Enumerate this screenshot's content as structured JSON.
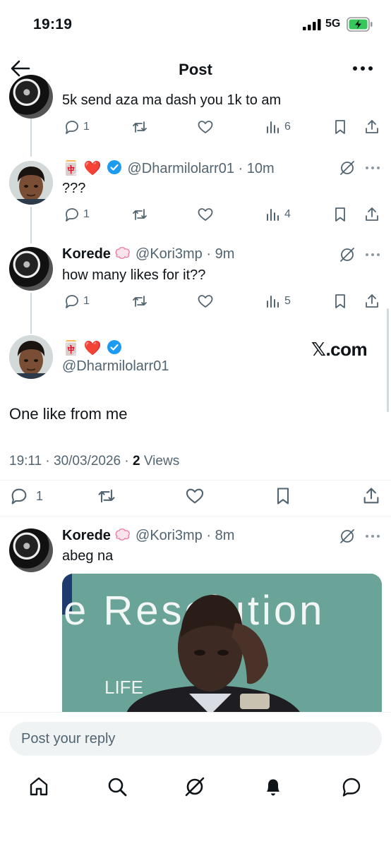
{
  "status_bar": {
    "time": "19:19",
    "network": "5G"
  },
  "header": {
    "title": "Post"
  },
  "replies_above": [
    {
      "text": "5k send aza ma dash you 1k to am",
      "stats": {
        "replies": "1",
        "views": "6"
      }
    },
    {
      "emoji": "🀄 ❤️",
      "handle": "@Dharmilolarr01",
      "time": "· 10m",
      "text": "???",
      "stats": {
        "replies": "1",
        "views": "4"
      }
    },
    {
      "name": "Korede",
      "handle": "@Kori3mp",
      "time": "· 9m",
      "text": "how many likes for it??",
      "stats": {
        "replies": "1",
        "views": "5"
      }
    }
  ],
  "main_post": {
    "emoji": "🀄 ❤️",
    "handle": "@Dharmilolarr01",
    "watermark": "𝕏.com",
    "text": "One like from me",
    "timestamp": "19:11 · 30/03/2026 · ",
    "views_count": "2",
    "views_label": " Views",
    "stats": {
      "replies": "1"
    }
  },
  "reply_below": {
    "name": "Korede",
    "handle": "@Kori3mp",
    "time": "· 8m",
    "text": "abeg na",
    "media_text": "e Resolution",
    "media_text2": "LIFE"
  },
  "composer": {
    "placeholder": "Post your reply"
  },
  "colors": {
    "verified": "#1d9bf0",
    "heart": "#e0245e",
    "secondary": "#536471",
    "battery": "#34c759"
  },
  "icons": [
    "back-arrow-icon",
    "more-icon",
    "reply-icon",
    "repost-icon",
    "like-icon",
    "views-icon",
    "bookmark-icon",
    "share-icon",
    "grok-icon",
    "home-icon",
    "search-icon",
    "bell-icon",
    "messages-icon"
  ]
}
